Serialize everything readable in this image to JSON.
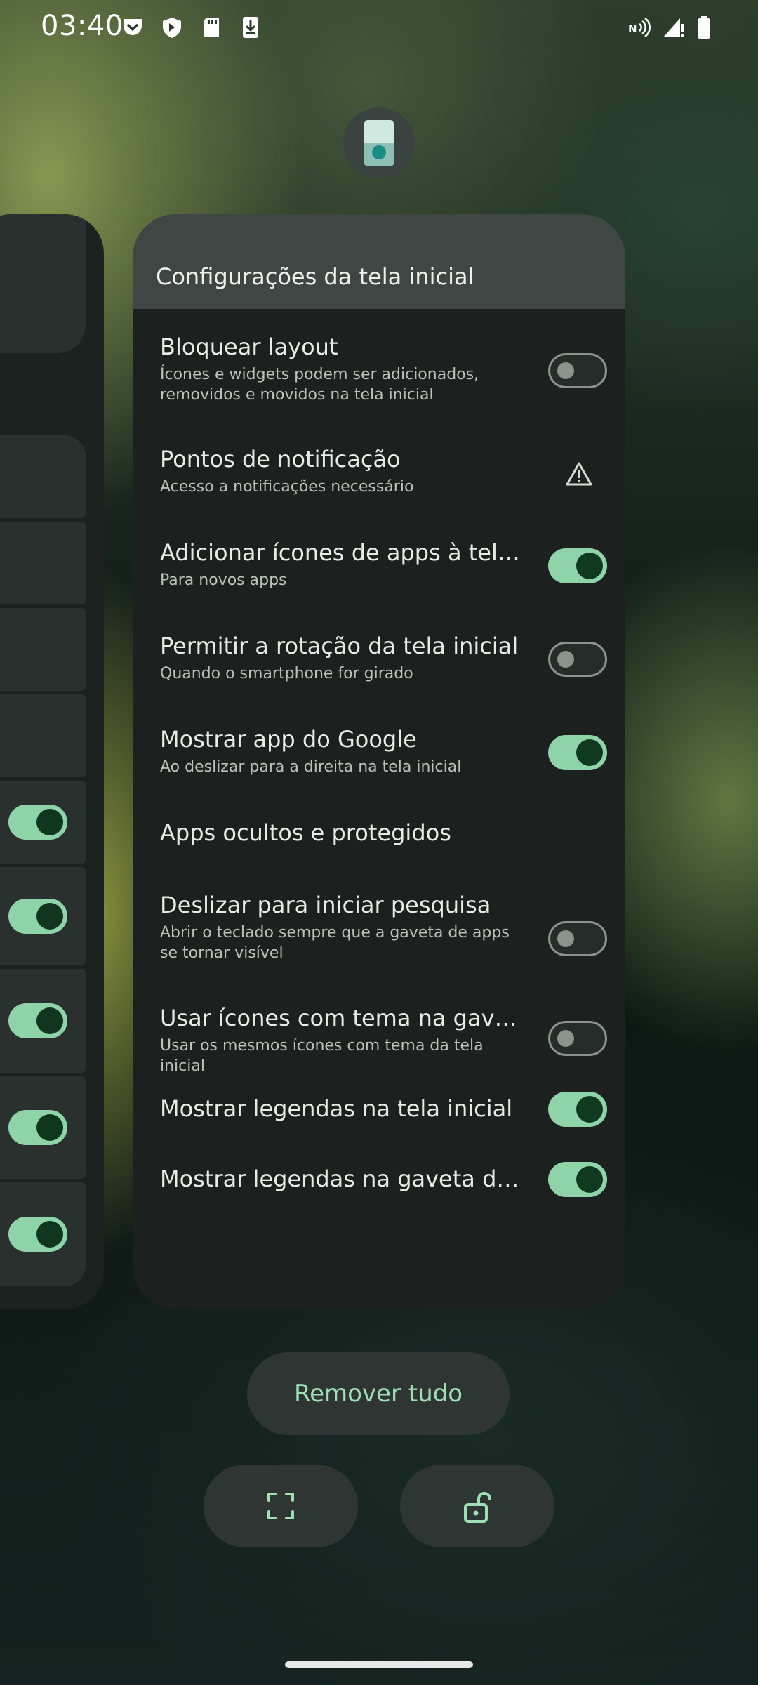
{
  "status_bar": {
    "time": "03:40",
    "icons": [
      "pocket-icon",
      "shield-icon",
      "sd-card-icon",
      "download-icon",
      "nfc-icon",
      "signal-icon",
      "battery-icon"
    ]
  },
  "settings": {
    "title": "Configurações da tela inicial",
    "rows": [
      {
        "title": "Bloquear layout",
        "subtitle": "Ícones e widgets podem ser adicionados, removidos e movidos na tela inicial",
        "control": "toggle-off"
      },
      {
        "title": "Pontos de notificação",
        "subtitle": "Acesso a notificações necessário",
        "control": "warning-icon"
      },
      {
        "title": "Adicionar ícones de apps à tela inicial",
        "subtitle": "Para novos apps",
        "control": "toggle-on"
      },
      {
        "title": "Permitir a rotação da tela inicial",
        "subtitle": "Quando o smartphone for girado",
        "control": "toggle-off"
      },
      {
        "title": "Mostrar app do Google",
        "subtitle": "Ao deslizar para a direita na tela inicial",
        "control": "toggle-on"
      },
      {
        "title": "Apps ocultos e protegidos",
        "subtitle": "",
        "control": "none"
      },
      {
        "title": "Deslizar para iniciar pesquisa",
        "subtitle": "Abrir o teclado sempre que a gaveta de apps se tornar visível",
        "control": "toggle-off"
      },
      {
        "title": "Usar ícones com tema na gaveta",
        "subtitle": "Usar os mesmos ícones com tema da tela inicial",
        "control": "toggle-off"
      },
      {
        "title": "Mostrar legendas na tela inicial",
        "subtitle": "",
        "control": "toggle-on"
      },
      {
        "title": "Mostrar legendas na gaveta de apps",
        "subtitle": "",
        "control": "toggle-on"
      }
    ]
  },
  "actions": {
    "remove_all": "Remover tudo",
    "screenshot_icon": "screenshot-icon",
    "unlock_icon": "unlock-icon"
  },
  "colors": {
    "accent": "#8fd3a8",
    "accent_text": "#9ee0b4",
    "card_bg": "#1c201e",
    "header_bg": "#3f4643"
  }
}
